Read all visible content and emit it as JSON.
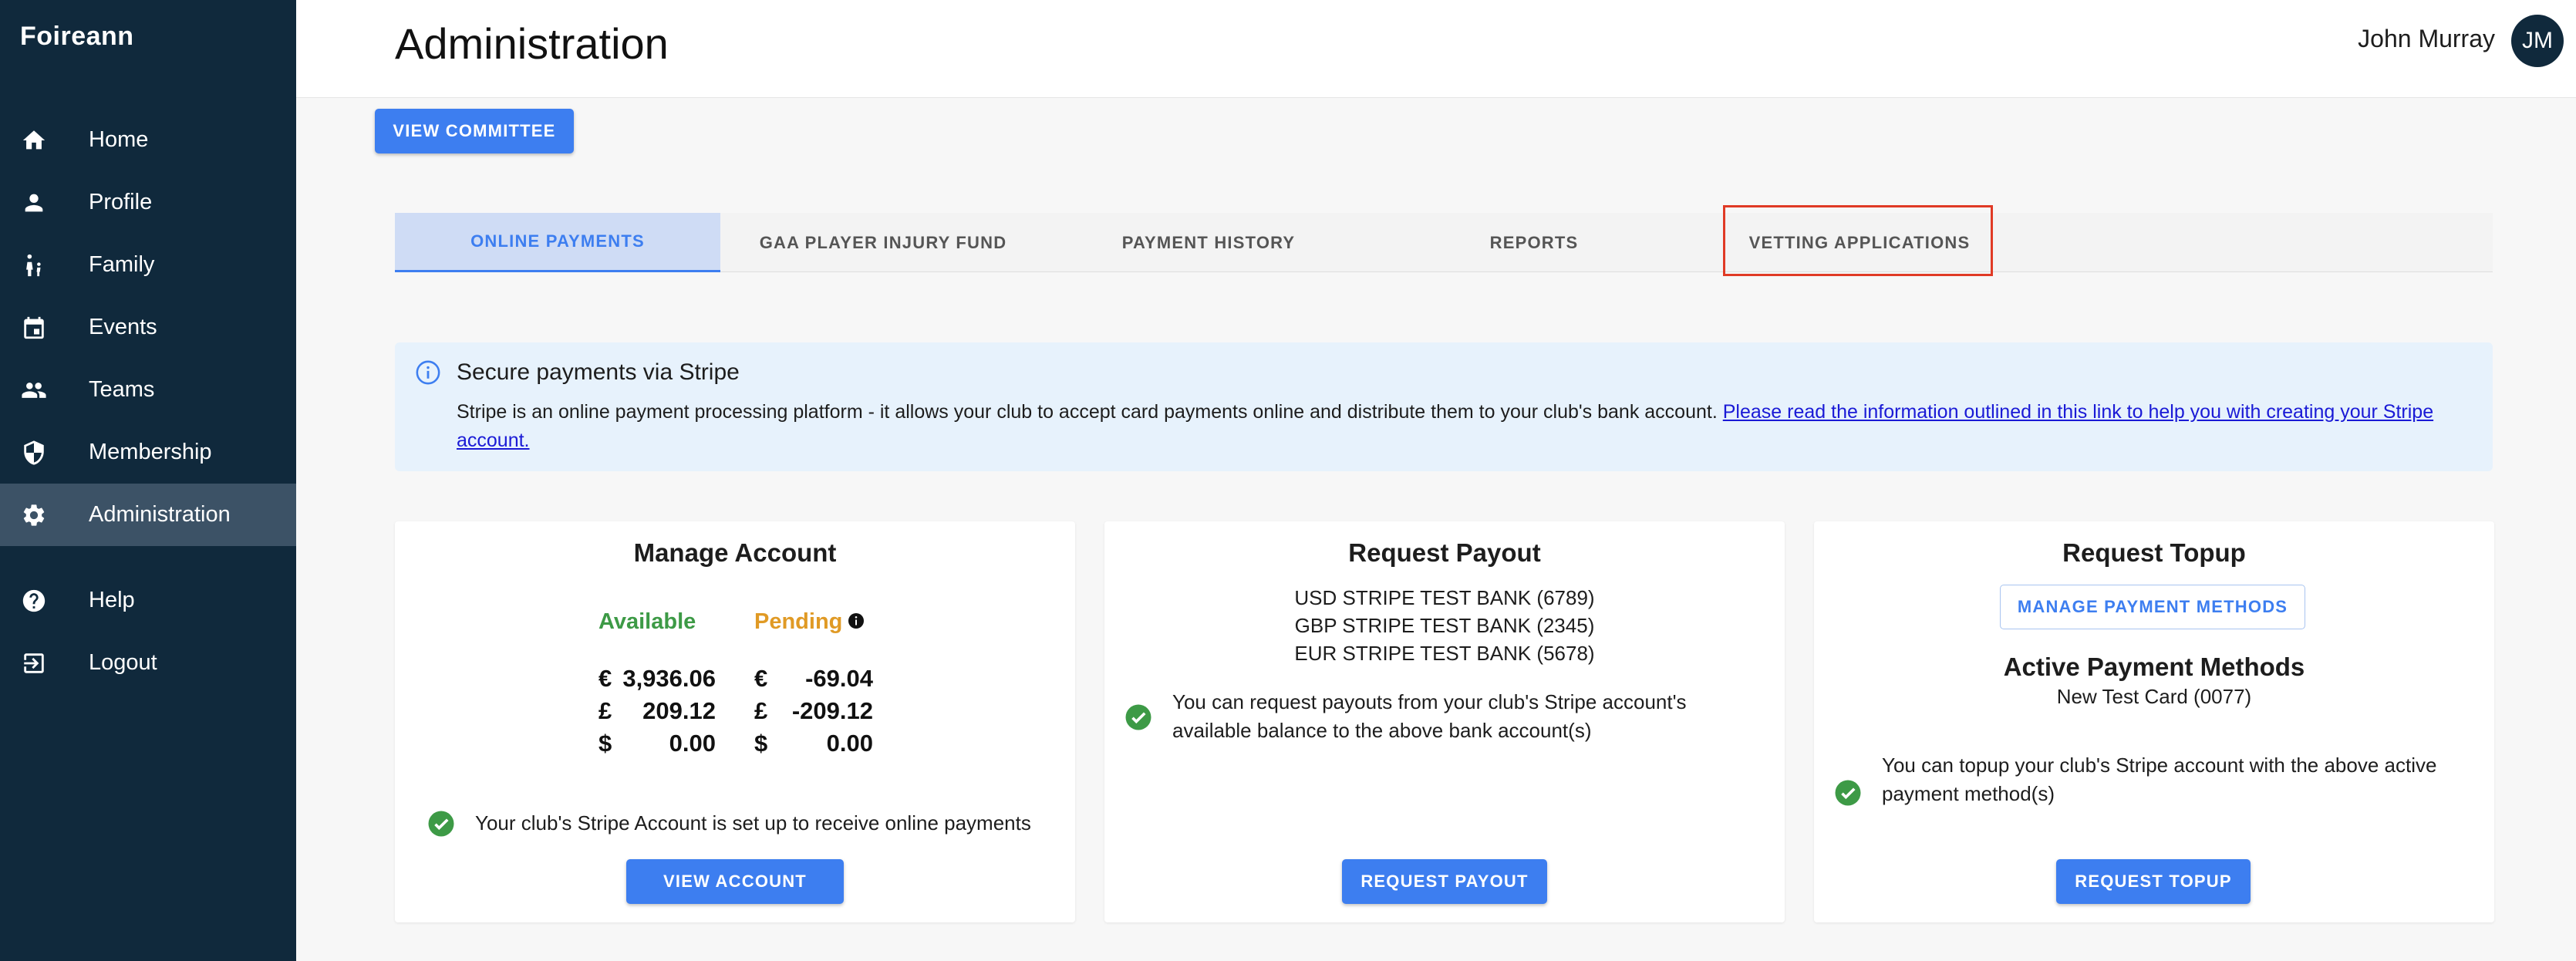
{
  "sidebar": {
    "brand": "Foireann",
    "items": [
      {
        "label": "Home",
        "icon": "home-icon"
      },
      {
        "label": "Profile",
        "icon": "person-icon"
      },
      {
        "label": "Family",
        "icon": "family-icon"
      },
      {
        "label": "Events",
        "icon": "calendar-icon"
      },
      {
        "label": "Teams",
        "icon": "group-icon"
      },
      {
        "label": "Membership",
        "icon": "shield-icon"
      },
      {
        "label": "Administration",
        "icon": "gear-icon",
        "active": true
      },
      {
        "label": "Help",
        "icon": "help-icon"
      },
      {
        "label": "Logout",
        "icon": "logout-icon"
      }
    ]
  },
  "header": {
    "title": "Administration",
    "user_name": "John Murray",
    "avatar_initials": "JM"
  },
  "view_committee_label": "VIEW COMMITTEE",
  "tabs": [
    {
      "label": "ONLINE PAYMENTS",
      "active": true
    },
    {
      "label": "GAA PLAYER INJURY FUND"
    },
    {
      "label": "PAYMENT HISTORY"
    },
    {
      "label": "REPORTS"
    },
    {
      "label": "VETTING APPLICATIONS"
    }
  ],
  "alert": {
    "title": "Secure payments via Stripe",
    "text": "Stripe is an online payment processing platform - it allows your club to accept card payments online and distribute them to your club's bank account. ",
    "link": "Please read the information outlined in this link to help you with creating your Stripe account."
  },
  "manage_account": {
    "title": "Manage Account",
    "available_label": "Available",
    "pending_label": "Pending",
    "available": [
      {
        "symbol": "€",
        "value": "3,936.06"
      },
      {
        "symbol": "£",
        "value": "209.12"
      },
      {
        "symbol": "$",
        "value": "0.00"
      }
    ],
    "pending": [
      {
        "symbol": "€",
        "value": "-69.04"
      },
      {
        "symbol": "£",
        "value": "-209.12"
      },
      {
        "symbol": "$",
        "value": "0.00"
      }
    ],
    "status_text": "Your club's Stripe Account is set up to receive online payments",
    "button_label": "VIEW ACCOUNT"
  },
  "request_payout": {
    "title": "Request Payout",
    "banks": [
      "USD STRIPE TEST BANK (6789)",
      "GBP STRIPE TEST BANK (2345)",
      "EUR STRIPE TEST BANK (5678)"
    ],
    "status_text": "You can request payouts from your club's Stripe account's available balance to the above bank account(s)",
    "button_label": "REQUEST PAYOUT"
  },
  "request_topup": {
    "title": "Request Topup",
    "manage_button_label": "MANAGE PAYMENT METHODS",
    "methods_title": "Active Payment Methods",
    "method": "New Test Card (0077)",
    "status_text": "You can topup your club's Stripe account with the above active payment method(s)",
    "button_label": "REQUEST TOPUP"
  },
  "colors": {
    "sidebar_bg": "#10293c",
    "accent": "#3d7ef0",
    "available": "#3d9a46",
    "pending": "#e09a25",
    "highlight": "#e03a25"
  }
}
